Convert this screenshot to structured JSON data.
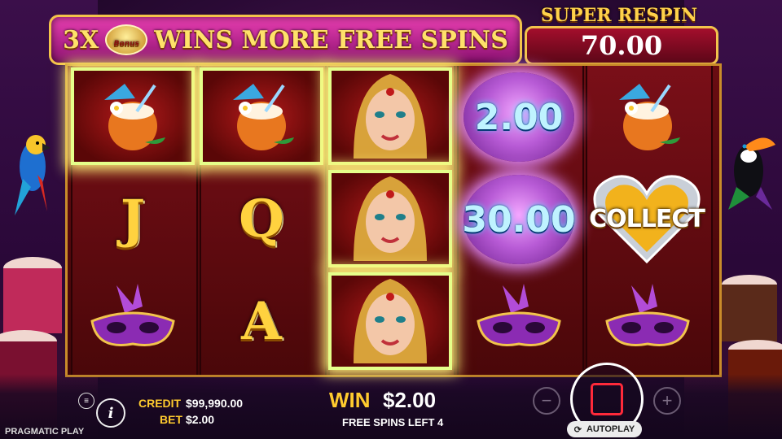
{
  "banner": {
    "prefix": "3X",
    "badge": "Bonus",
    "text": "WINS MORE FREE SPINS"
  },
  "super_respin": {
    "title": "SUPER RESPIN",
    "value": "70.00"
  },
  "reels": {
    "columns": [
      [
        "coconut-drink",
        "J",
        "mask"
      ],
      [
        "coconut-drink",
        "Q",
        "A"
      ],
      [
        "carnival-queen",
        "carnival-queen",
        "carnival-queen"
      ],
      [
        "orb",
        "orb",
        "mask"
      ],
      [
        "coconut-drink",
        "collect-heart",
        "mask"
      ]
    ],
    "letters": {
      "J": "J",
      "Q": "Q",
      "A": "A"
    },
    "orb_values": [
      "2.00",
      "30.00"
    ],
    "collect_label": "COLLECT"
  },
  "bottom": {
    "credit_label": "CREDIT",
    "credit_value": "$99,990.00",
    "bet_label": "BET",
    "bet_value": "$2.00",
    "win_label": "WIN",
    "win_value": "$2.00",
    "free_spins": "FREE SPINS LEFT 4",
    "autoplay_label": "AUTOPLAY",
    "minus": "−",
    "plus": "+",
    "info": "i",
    "menu": "≡",
    "brand": "PRAGMATIC PLAY"
  },
  "colors": {
    "accent_gold": "#ffcb2e",
    "spin_red": "#ff2a3a",
    "banner_pink": "#e93fb1",
    "orb_purple": "#b85bd6"
  }
}
